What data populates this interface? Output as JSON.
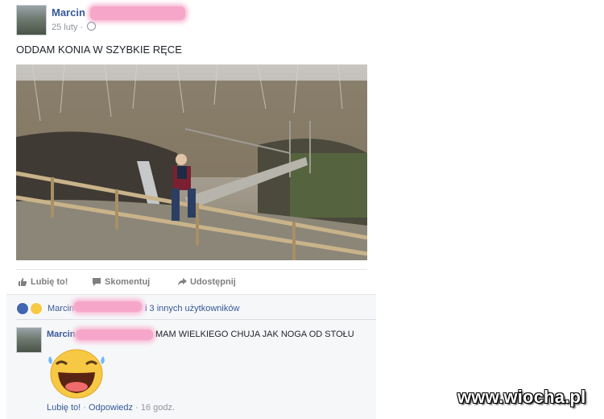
{
  "post": {
    "author": "Marcin",
    "date": "25 luty",
    "separator": "·",
    "text": "ODDAM KONIA W SZYBKIE RĘCE"
  },
  "actions": {
    "like": "Lubię to!",
    "comment": "Skomentuj",
    "share": "Udostępnij"
  },
  "reactions": {
    "name": "Marcin",
    "others": "i 3 innych użytkowników"
  },
  "comment": {
    "author": "Marcin",
    "text": "MAM WIELKIEGO CHUJA JAK NOGA OD STOŁU",
    "like": "Lubię to!",
    "reply": "Odpowiedz",
    "time": "16 godz.",
    "dot": "·"
  },
  "watermark": "www.wiocha.pl",
  "colors": {
    "link": "#365899",
    "muted": "#90949c",
    "like_blue": "#4267b2",
    "haha_yellow": "#f7c843",
    "redaction_pink": "#f6a7c9"
  },
  "icons": [
    "thumbs-up-icon",
    "comment-icon",
    "share-icon",
    "globe-icon",
    "haha-emoji-icon"
  ]
}
